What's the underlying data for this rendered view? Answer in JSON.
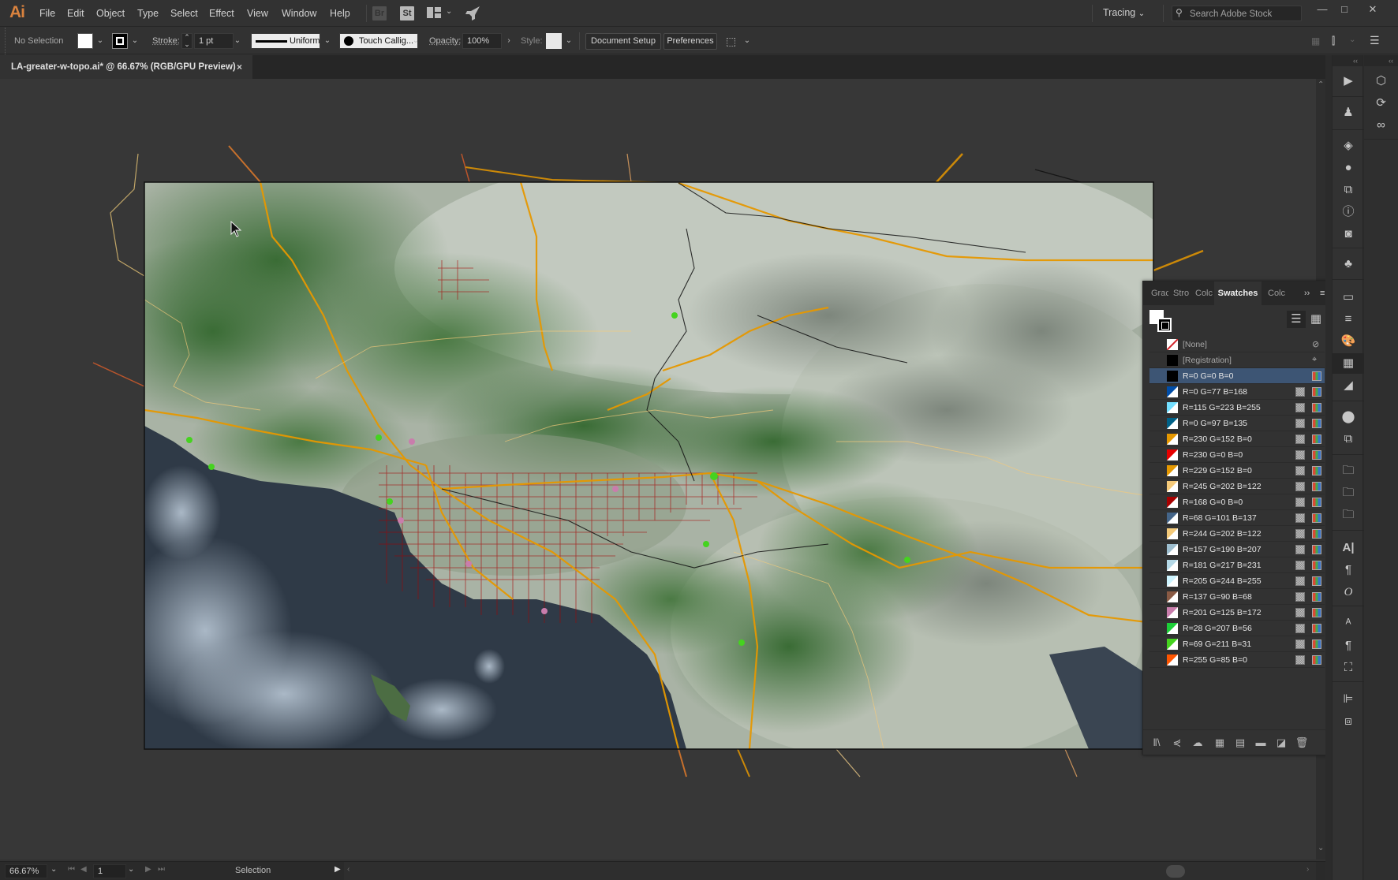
{
  "app": {
    "logo": "Ai",
    "menu": [
      "File",
      "Edit",
      "Object",
      "Type",
      "Select",
      "Effect",
      "View",
      "Window",
      "Help"
    ],
    "bridge_label": "Br",
    "stock_label": "St",
    "workspace": "Tracing",
    "stock_search_placeholder": "Search Adobe Stock",
    "window_controls": {
      "minimize": "—",
      "maximize": "□",
      "close": "✕"
    }
  },
  "control_bar": {
    "selection_status": "No Selection",
    "stroke_label": "Stroke:",
    "stroke_weight": "1 pt",
    "stroke_profile": "Uniform",
    "brush": "Touch Callig...",
    "opacity_label": "Opacity:",
    "opacity_value": "100%",
    "style_label": "Style:",
    "document_setup": "Document Setup",
    "preferences": "Preferences"
  },
  "document": {
    "tab_title": "LA-greater-w-topo.ai* @ 66.67% (RGB/GPU Preview)",
    "close": "×"
  },
  "status_bar": {
    "zoom": "66.67%",
    "artboard_number": "1",
    "current_tool": "Selection"
  },
  "swatches_panel": {
    "tabs": [
      "Grac",
      "Stro",
      "Colc",
      "Swatches",
      "Colc"
    ],
    "active_tab": "Swatches",
    "expand": "››",
    "menu": "≡",
    "swatches": [
      {
        "name": "[None]",
        "color": "none",
        "special": true
      },
      {
        "name": "[Registration]",
        "color": "#000000",
        "special": true
      },
      {
        "name": "R=0 G=0 B=0",
        "color": "#000000",
        "selected": true,
        "global": false
      },
      {
        "name": "R=0 G=77 B=168",
        "color": "#004da8",
        "global": true
      },
      {
        "name": "R=115 G=223 B=255",
        "color": "#73dfff",
        "global": true
      },
      {
        "name": "R=0 G=97 B=135",
        "color": "#006187",
        "global": true
      },
      {
        "name": "R=230 G=152 B=0",
        "color": "#e69800",
        "global": true
      },
      {
        "name": "R=230 G=0 B=0",
        "color": "#e60000",
        "global": true
      },
      {
        "name": "R=229 G=152 B=0",
        "color": "#e59800",
        "global": true
      },
      {
        "name": "R=245 G=202 B=122",
        "color": "#f5ca7a",
        "global": true
      },
      {
        "name": "R=168 G=0 B=0",
        "color": "#a80000",
        "global": true
      },
      {
        "name": "R=68 G=101 B=137",
        "color": "#446589",
        "global": true
      },
      {
        "name": "R=244 G=202 B=122",
        "color": "#f4ca7a",
        "global": true
      },
      {
        "name": "R=157 G=190 B=207",
        "color": "#9dbecf",
        "global": true
      },
      {
        "name": "R=181 G=217 B=231",
        "color": "#b5d9e7",
        "global": true
      },
      {
        "name": "R=205 G=244 B=255",
        "color": "#cdf4ff",
        "global": true
      },
      {
        "name": "R=137 G=90 B=68",
        "color": "#895a44",
        "global": true
      },
      {
        "name": "R=201 G=125 B=172",
        "color": "#c97dac",
        "global": true
      },
      {
        "name": "R=28 G=207 B=56",
        "color": "#1ccf38",
        "global": true
      },
      {
        "name": "R=69 G=211 B=31",
        "color": "#45d31f",
        "global": true
      },
      {
        "name": "R=255 G=85 B=0",
        "color": "#ff5500",
        "global": true
      }
    ]
  },
  "map": {
    "water_color": "#2f3a47",
    "mountain_color": "#3f6b3a",
    "desert_color": "#b9c2b5",
    "highway_color": "#e69800",
    "road_color": "#a80000",
    "rail_color": "#111111",
    "boundary_color": "#f5ca7a"
  }
}
